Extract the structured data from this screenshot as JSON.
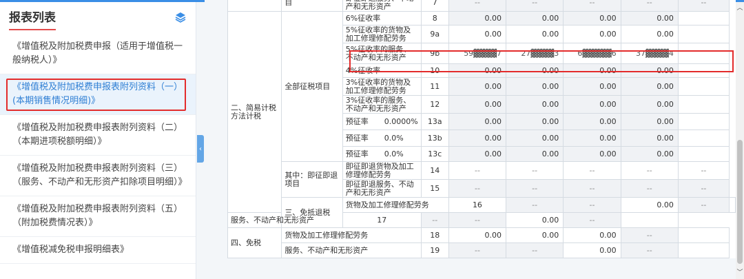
{
  "sidebar": {
    "title": "报表列表",
    "items": [
      {
        "label": "《增值税及附加税费申报（适用于增值税一般纳税人）》"
      },
      {
        "label": "《增值税及附加税费申报表附列资料（一）(本期销售情况明细)》"
      },
      {
        "label": "《增值税及附加税费申报表附列资料（二）（本期进项税额明细）》"
      },
      {
        "label": "《增值税及附加税费申报表附列资料（三）（服务、不动产和无形资产扣除项目明细）》"
      },
      {
        "label": "《增值税及附加税费申报表附列资料（五）（附加税费情况表）》"
      },
      {
        "label": "《增值税减免税申报明细表》"
      }
    ]
  },
  "table": {
    "top_partial": {
      "label": "目",
      "item": "即征即退服务、不动产和无形资产",
      "row": "7",
      "dash": "--"
    },
    "section2": "二、简易计税方法计税",
    "group_all": "全部征税项目",
    "group_refund": "其中：即征即退项目",
    "rows_all": [
      {
        "item": "6%征收率",
        "row": "8",
        "vals": [
          "0.00",
          "0.00",
          "0.00",
          "0.00"
        ]
      },
      {
        "item": "5%征收率的货物及加工修理修配劳务",
        "row": "9a",
        "vals": [
          "0.00",
          "0.00",
          "0.00",
          "0.00"
        ]
      },
      {
        "item": "5%征收率的服务、不动产和无形资产",
        "row": "9b",
        "vals": [
          "59▓▓▓▓7",
          "27▓▓▓▓3",
          "6▓▓▓▓▓6",
          "37▓▓▓▓4"
        ]
      },
      {
        "item": "4%征收率",
        "row": "10",
        "vals": [
          "0.00",
          "0.00",
          "0.00",
          "0.00"
        ]
      },
      {
        "item": "3%征收率的货物及加工修理修配劳务",
        "row": "11",
        "vals": [
          "0.00",
          "0.00",
          "0.00",
          "0.00"
        ]
      },
      {
        "item": "3%征收率的服务、不动产和无形资产",
        "row": "12",
        "vals": [
          "0.00",
          "0.00",
          "0.00",
          "0.00"
        ]
      }
    ],
    "prepay_label": "预征率",
    "rows_prepay": [
      {
        "rate": "0.0000%",
        "row": "13a",
        "vals": [
          "0.00",
          "0.00",
          "0.00",
          "0.00"
        ]
      },
      {
        "rate": "0.0%",
        "row": "13b",
        "vals": [
          "0.00",
          "0.00",
          "0.00",
          "0.00"
        ]
      },
      {
        "rate": "0.0%",
        "row": "13c",
        "vals": [
          "0.00",
          "0.00",
          "0.00",
          "0.00"
        ]
      }
    ],
    "rows_refund": [
      {
        "item": "即征即退货物及加工修理修配劳务",
        "row": "14"
      },
      {
        "item": "即征即退服务、不动产和无形资产",
        "row": "15"
      }
    ],
    "section3": "三、免抵退税",
    "section4": "四、免税",
    "item_goods": "货物及加工修理修配劳务",
    "item_service": "服务、不动产和无形资产",
    "row16": "16",
    "row17": "17",
    "row18": "18",
    "row19": "19",
    "zero": "0.00",
    "dash": "--"
  },
  "icons": {
    "layers": "layers-icon",
    "collapse": "chevron-left-icon",
    "scroll_up": "chevron-up-icon",
    "scroll_down": "chevron-down-icon"
  },
  "colors": {
    "accent": "#2f7fd4",
    "highlight_border": "#e32b2b",
    "title_underline": "#e34b4b"
  }
}
